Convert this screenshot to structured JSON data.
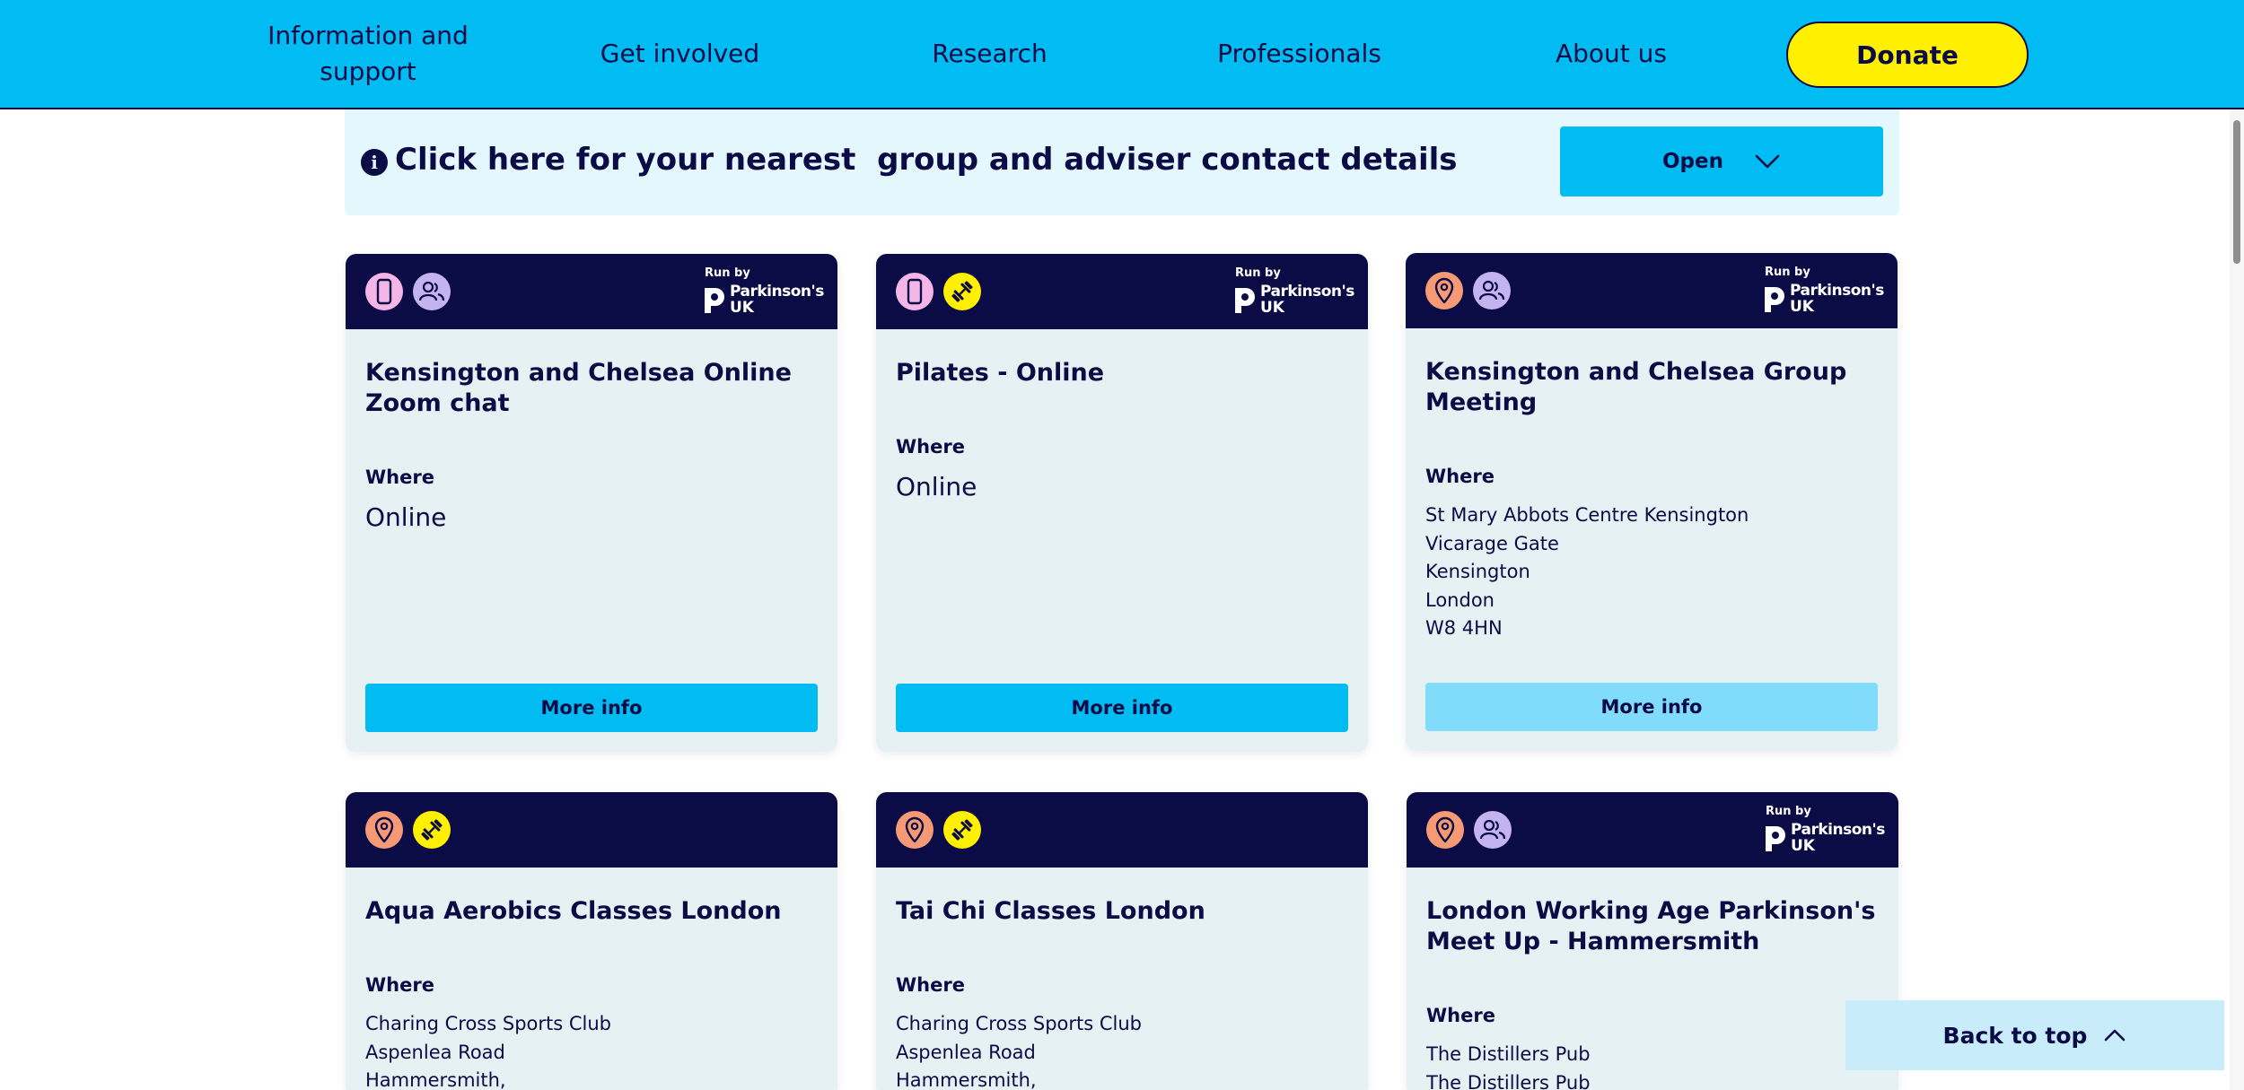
{
  "nav": {
    "items": [
      "Information and support",
      "Get involved",
      "Research",
      "Professionals",
      "About us"
    ],
    "donate_label": "Donate"
  },
  "banner": {
    "text": "Click here for your nearest  group and adviser contact details",
    "button_label": "Open"
  },
  "run_by": {
    "label": "Run by",
    "brand": "Parkinson's",
    "country": "UK"
  },
  "cards": [
    {
      "icons": [
        "phone-icon",
        "people-icon"
      ],
      "run_by": true,
      "title": "Kensington and Chelsea Online Zoom chat",
      "where_label": "Where",
      "where_online": "Online",
      "address": [],
      "button_label": "More info",
      "button_color": "#00bcf2"
    },
    {
      "icons": [
        "phone-icon",
        "dumbbell-icon"
      ],
      "run_by": true,
      "title": "Pilates - Online",
      "where_label": "Where",
      "where_online": "Online",
      "address": [],
      "button_label": "More info",
      "button_color": "#00bcf2"
    },
    {
      "icons": [
        "location-pin-icon",
        "people-icon"
      ],
      "run_by": true,
      "title": "Kensington and Chelsea Group Meeting",
      "where_label": "Where",
      "where_online": "",
      "address": [
        "St Mary Abbots Centre Kensington",
        "Vicarage Gate",
        "Kensington",
        "London",
        "W8 4HN"
      ],
      "button_label": "More info",
      "button_color": "#80dcfa"
    },
    {
      "icons": [
        "location-pin-icon",
        "dumbbell-icon"
      ],
      "run_by": false,
      "title": "Aqua Aerobics Classes London",
      "where_label": "Where",
      "where_online": "",
      "address": [
        "Charing Cross Sports Club",
        "Aspenlea Road",
        "Hammersmith,"
      ]
    },
    {
      "icons": [
        "location-pin-icon",
        "dumbbell-icon"
      ],
      "run_by": false,
      "title": "Tai Chi Classes London",
      "where_label": "Where",
      "where_online": "",
      "address": [
        "Charing Cross Sports Club",
        "Aspenlea Road",
        "Hammersmith,"
      ]
    },
    {
      "icons": [
        "location-pin-icon",
        "people-icon"
      ],
      "run_by": true,
      "title": "London Working Age Parkinson's Meet Up - Hammersmith",
      "where_label": "Where",
      "where_online": "",
      "address": [
        "The Distillers Pub",
        "The Distillers Pub"
      ]
    }
  ],
  "back_to_top": {
    "label": "Back to top"
  },
  "colors": {
    "nav_bg": "#00bcf2",
    "navy": "#0b0b45",
    "donate": "#ffef00",
    "banner_bg": "#e4f7fd",
    "card_bg": "#e6f1f4",
    "button": "#00bcf2",
    "button_hover": "#80dcfa",
    "back_to_top_bg": "#c8ecfa"
  }
}
